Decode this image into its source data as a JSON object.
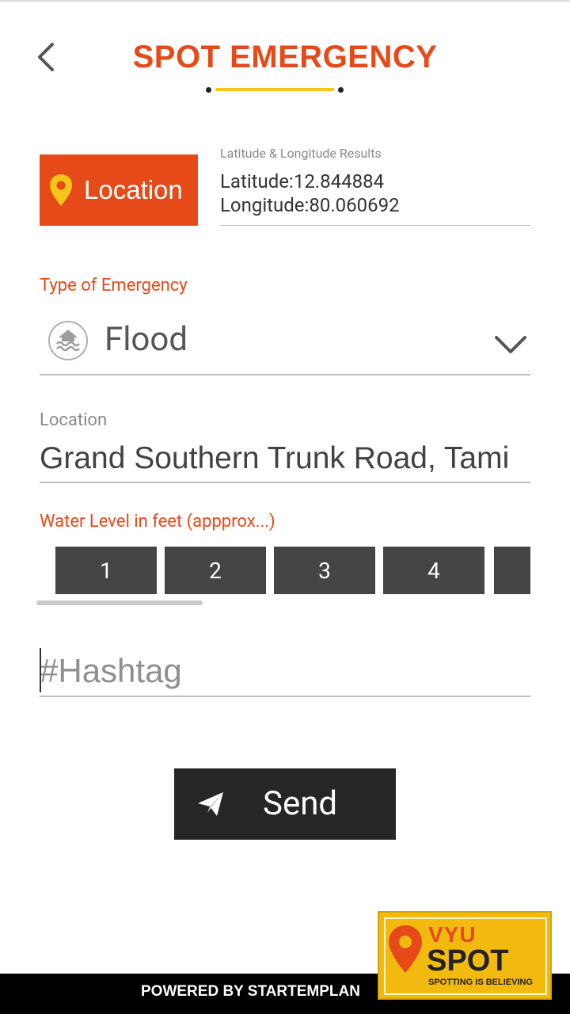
{
  "header": {
    "title": "SPOT EMERGENCY",
    "back_icon": "chevron-left-icon"
  },
  "location_button": {
    "label": "Location",
    "icon": "map-pin-icon"
  },
  "coordinates": {
    "caption": "Latitude & Longitude Results",
    "latitude_label": "Latitude:",
    "latitude": "12.844884",
    "longitude_label": "Longitude:",
    "longitude": "80.060692"
  },
  "emergency_type": {
    "label": "Type of Emergency",
    "selected": "Flood",
    "icon": "flood-icon"
  },
  "location_field": {
    "label": "Location",
    "value": "Grand Southern Trunk Road, Tami"
  },
  "water_level": {
    "label": "Water Level in feet (appprox...)",
    "options": [
      "1",
      "2",
      "3",
      "4",
      ""
    ]
  },
  "hashtag": {
    "placeholder": "#Hashtag"
  },
  "send_button": {
    "label": "Send",
    "icon": "paper-plane-icon"
  },
  "footer": {
    "powered_by": "POWERED BY STARTEMPLAN"
  },
  "logo": {
    "line1": "VYU",
    "line2": "SPOT",
    "tagline": "SPOTTING IS BELIEVING"
  },
  "colors": {
    "accent": "#e64a19",
    "highlight": "#f5c518",
    "dark": "#262626",
    "level_tile": "#454545"
  }
}
